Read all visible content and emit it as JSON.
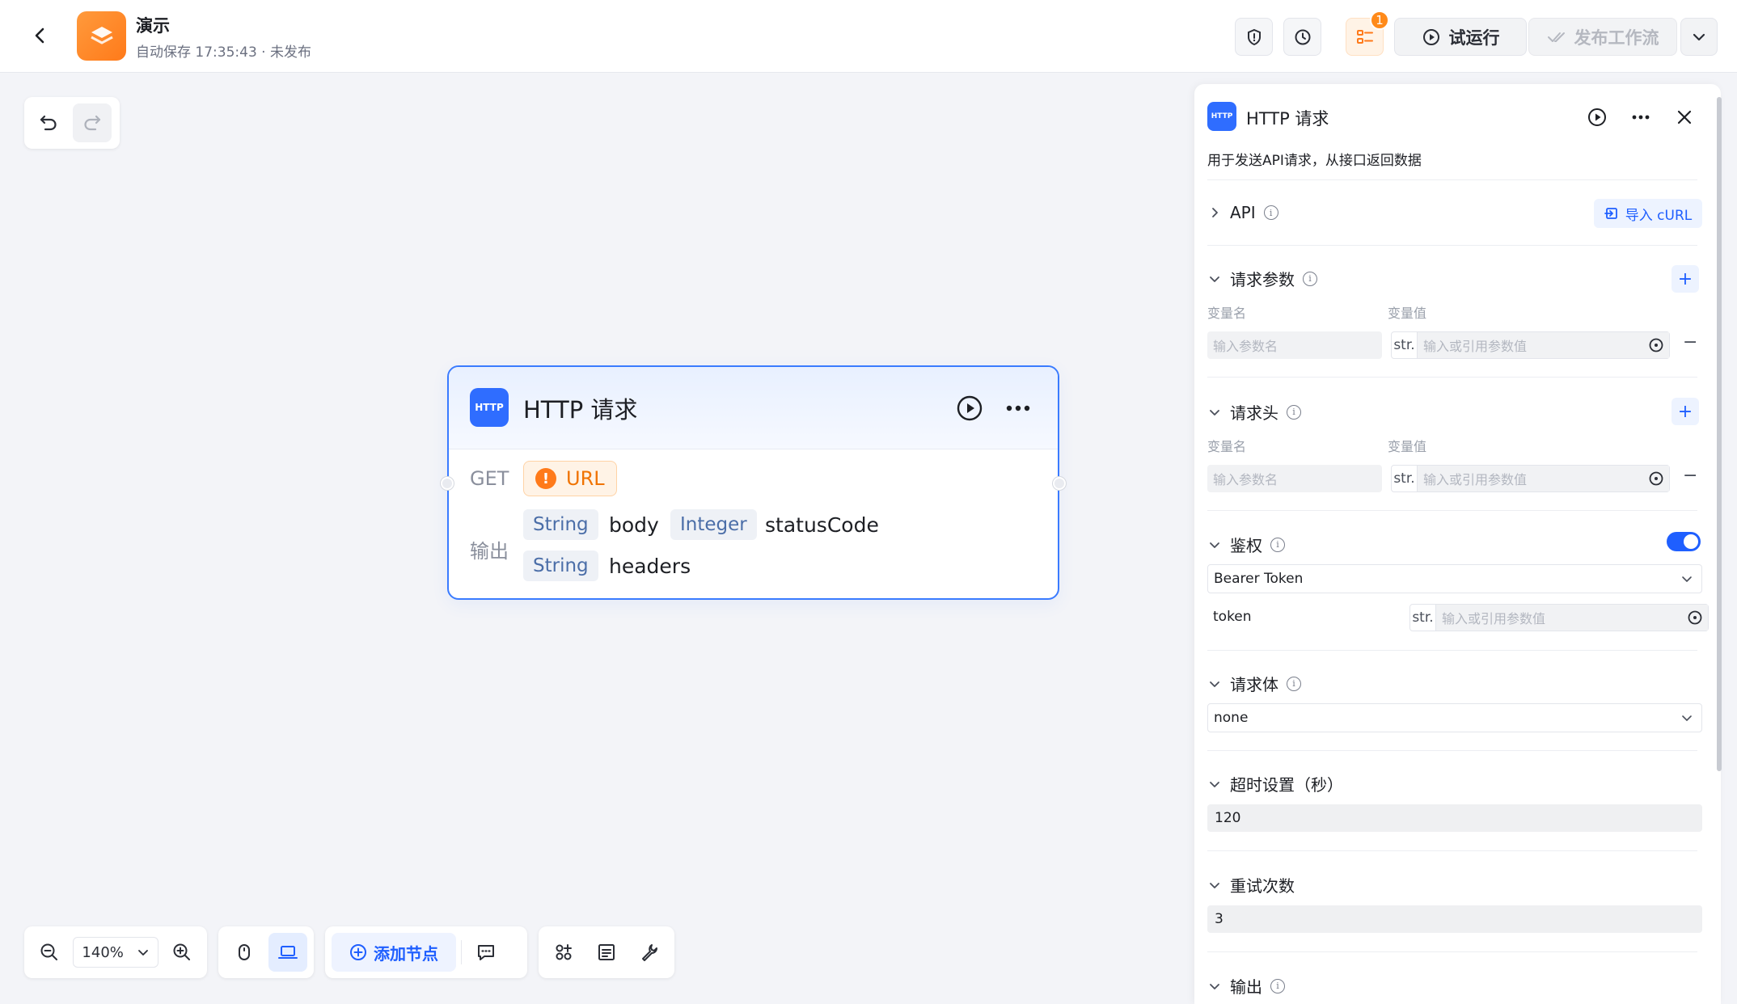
{
  "header": {
    "title": "演示",
    "subtitle": "自动保存 17:35:43 · 未发布",
    "badge_count": "1",
    "run_label": "试运行",
    "publish_label": "发布工作流"
  },
  "node": {
    "title": "HTTP 请求",
    "logo_text": "HTTP",
    "method": "GET",
    "url_label": "URL",
    "warning_glyph": "!",
    "output_label": "输出",
    "outputs": [
      {
        "type": "String",
        "name": "body"
      },
      {
        "type": "Integer",
        "name": "statusCode"
      },
      {
        "type": "String",
        "name": "headers"
      }
    ]
  },
  "toolbar": {
    "zoom": "140%",
    "add_node_label": "添加节点"
  },
  "panel": {
    "title": "HTTP 请求",
    "logo_text": "HTTP",
    "description": "用于发送API请求，从接口返回数据",
    "api_label": "API",
    "import_label": "导入 cURL",
    "params_label": "请求参数",
    "headers_label": "请求头",
    "col_name": "变量名",
    "col_value": "变量值",
    "name_placeholder": "输入参数名",
    "value_placeholder": "输入或引用参数值",
    "str_tag": "str.",
    "auth_label": "鉴权",
    "auth_type": "Bearer Token",
    "token_label": "token",
    "body_label": "请求体",
    "body_type": "none",
    "timeout_label": "超时设置（秒）",
    "timeout_value": "120",
    "retry_label": "重试次数",
    "retry_value": "3",
    "output_label": "输出"
  },
  "colors": {
    "accent": "#1f5fff",
    "node_border": "#3a7bff",
    "warning": "#ff7a1a",
    "brand": "#ff8a1a"
  }
}
